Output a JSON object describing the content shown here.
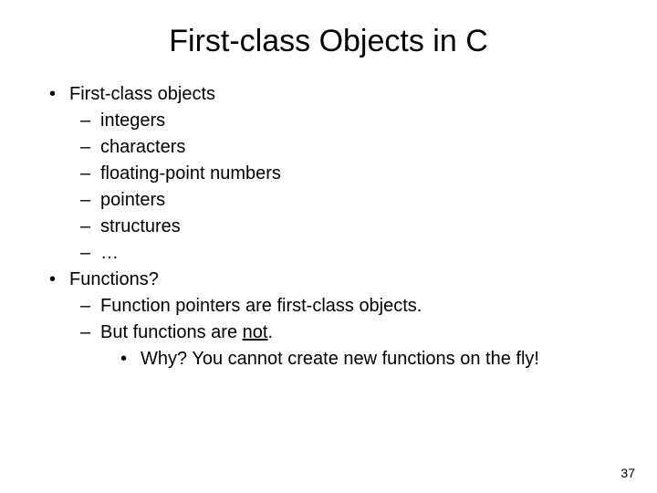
{
  "slide": {
    "title": "First-class Objects in C",
    "pageNumber": "37",
    "bullets": {
      "b1": "First-class objects",
      "b1_1": "integers",
      "b1_2": "characters",
      "b1_3": "floating-point numbers",
      "b1_4": "pointers",
      "b1_5": "structures",
      "b1_6": "…",
      "b2": "Functions?",
      "b2_1": "Function pointers are first-class objects.",
      "b2_2_pre": "But functions are ",
      "b2_2_u": "not",
      "b2_2_post": ".",
      "b2_2_1": "Why? You cannot create new functions on the fly!"
    },
    "markers": {
      "dot": "•",
      "dash": "–"
    }
  }
}
